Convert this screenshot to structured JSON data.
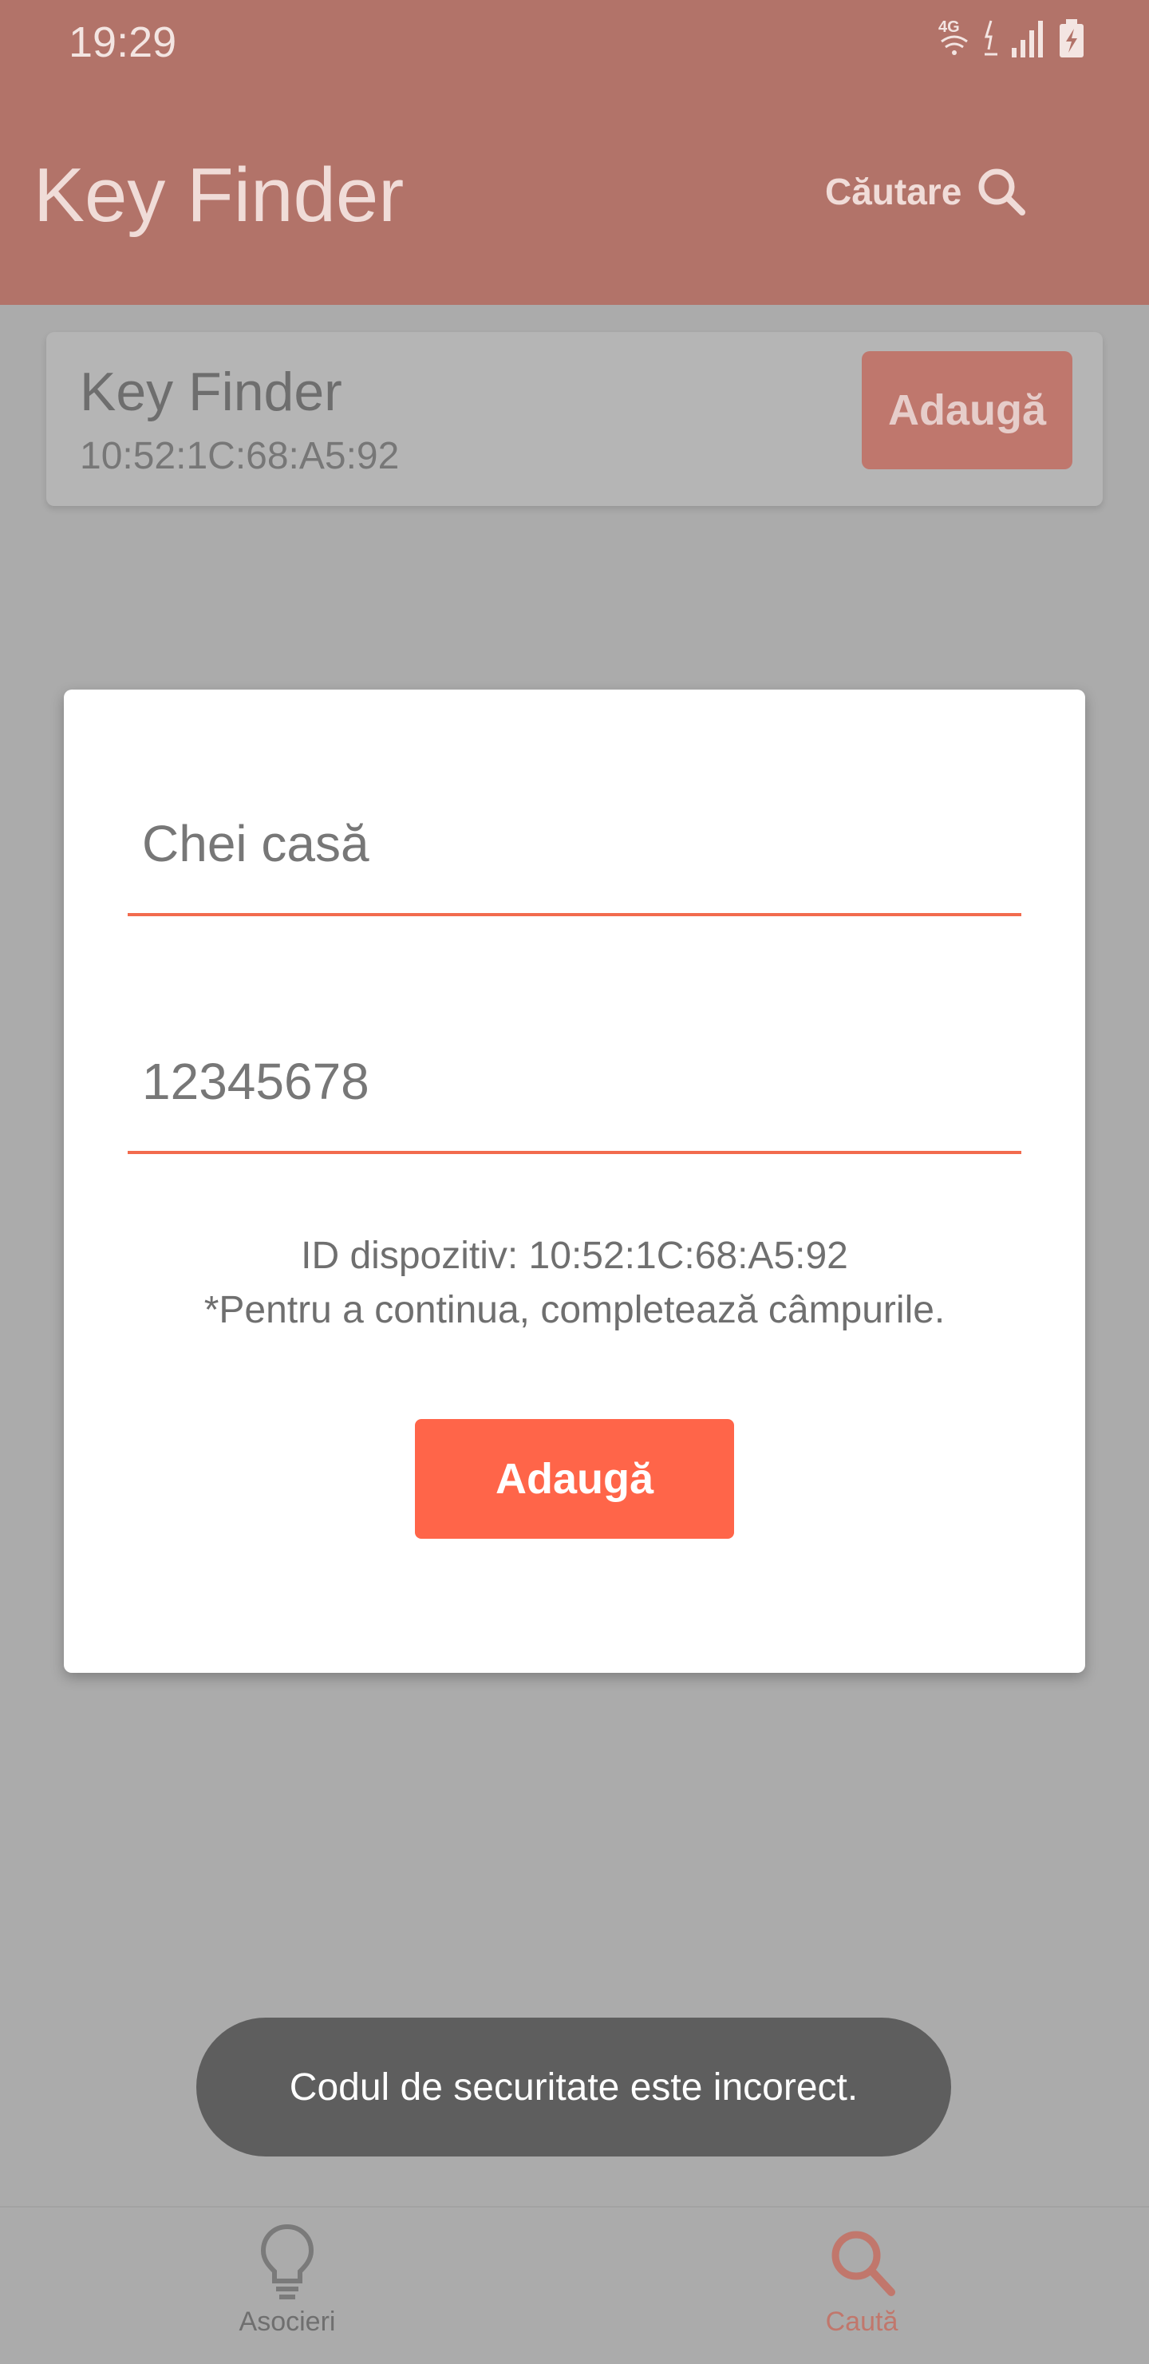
{
  "status_bar": {
    "time": "19:29",
    "icons": [
      "network-4g-icon",
      "wifi-icon",
      "signal-icon",
      "battery-charging-icon"
    ],
    "network_label": "4G"
  },
  "app_bar": {
    "title": "Key Finder",
    "search_label": "Căutare",
    "search_icon": "search-icon"
  },
  "device_card": {
    "name": "Key Finder",
    "mac": "10:52:1C:68:A5:92",
    "add_label": "Adaugă"
  },
  "dialog": {
    "name_field_value": "Chei casă",
    "code_field_value": "12345678",
    "device_id_text": "ID dispozitiv: 10:52:1C:68:A5:92",
    "hint_text": "*Pentru a continua, completează câmpurile.",
    "add_label": "Adaugă"
  },
  "toast": {
    "message": "Codul de securitate este incorect."
  },
  "bottom_nav": {
    "items": [
      {
        "label": "Asocieri",
        "icon": "lightbulb-icon",
        "active": false
      },
      {
        "label": "Caută",
        "icon": "search-icon",
        "active": true
      }
    ]
  },
  "colors": {
    "primary": "#ff6549",
    "appbar_dimmed": "#b27369",
    "overlay": "#ababab"
  }
}
